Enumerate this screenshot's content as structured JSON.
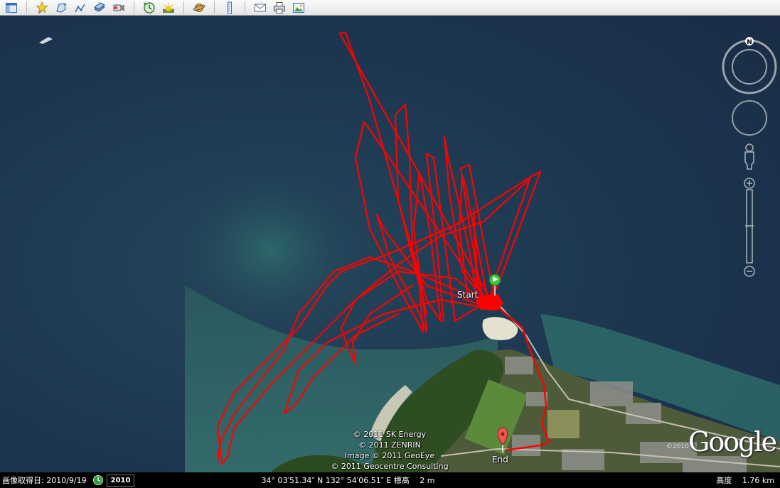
{
  "toolbar": {
    "buttons": [
      {
        "name": "sidebar-toggle-button",
        "icon": "sidebar-icon"
      },
      {
        "name": "add-placemark-button",
        "icon": "pushpin-star-icon"
      },
      {
        "name": "add-polygon-button",
        "icon": "polygon-icon"
      },
      {
        "name": "add-path-button",
        "icon": "path-icon"
      },
      {
        "name": "add-image-overlay-button",
        "icon": "image-overlay-icon"
      },
      {
        "name": "record-tour-button",
        "icon": "record-tour-icon"
      },
      {
        "name": "historical-imagery-button",
        "icon": "clock-icon"
      },
      {
        "name": "sunlight-button",
        "icon": "sun-icon"
      },
      {
        "name": "switch-planet-button",
        "icon": "planet-icon"
      },
      {
        "name": "ruler-button",
        "icon": "ruler-icon"
      },
      {
        "name": "email-button",
        "icon": "envelope-icon"
      },
      {
        "name": "print-button",
        "icon": "printer-icon"
      },
      {
        "name": "save-image-button",
        "icon": "save-image-icon"
      }
    ]
  },
  "map": {
    "start_label": "Start",
    "end_label": "End",
    "track_color": "#ff0000",
    "start_marker_color": "#36c63a",
    "end_marker_color": "#f0554f",
    "copyrights": [
      "© 2011 SK Energy",
      "© 2011 ZENRIN",
      "Image © 2011 GeoEye",
      "© 2011 Geocentre Consulting"
    ],
    "logo_text": "Google",
    "logo_year": "©2010"
  },
  "navigation": {
    "north_label": "N"
  },
  "status": {
    "imagery_date": "画像取得日: 2010/9/19",
    "year_badge": "2010",
    "coordinates": "34° 03′51.34″ N 132° 54′06.51″ E 標高　 2 m",
    "eye_altitude": "高度　 1.76 km"
  }
}
